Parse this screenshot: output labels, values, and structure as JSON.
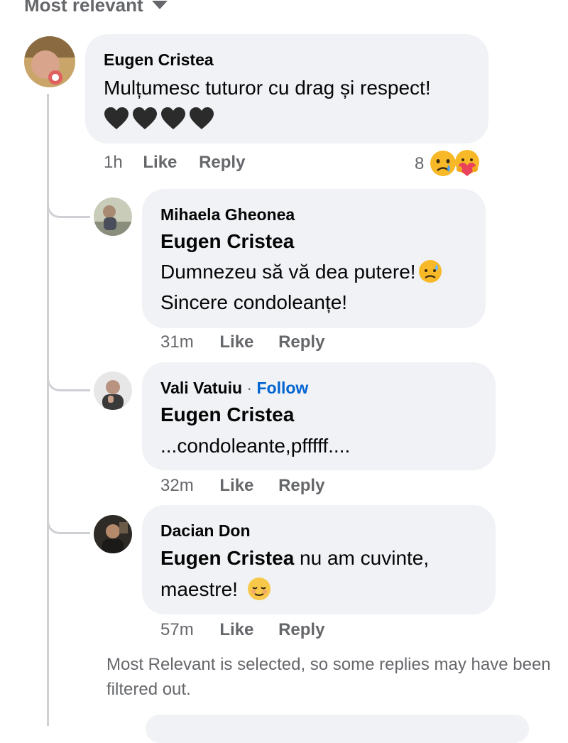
{
  "sort": {
    "label": "Most relevant"
  },
  "main_comment": {
    "author": "Eugen Cristea",
    "text": "Mulțumesc tuturor cu drag și respect!",
    "hearts": "🖤🖤🖤🖤",
    "time": "1h",
    "like_label": "Like",
    "reply_label": "Reply",
    "reaction_count": "8",
    "reactions": [
      "sad-crying-emoji",
      "care-hug-emoji"
    ]
  },
  "replies": [
    {
      "author": "Mihaela Gheonea",
      "tag": "Eugen Cristea",
      "line1": "Dumnezeu să vă dea putere!",
      "line2": "Sincere condoleanțe!",
      "time": "31m",
      "like_label": "Like",
      "reply_label": "Reply"
    },
    {
      "author": "Vali Vatuiu",
      "follow_label": "Follow",
      "tag": "Eugen Cristea",
      "line1": "...condoleante,pfffff....",
      "time": "32m",
      "like_label": "Like",
      "reply_label": "Reply"
    },
    {
      "author": "Dacian Don",
      "tag": "Eugen Cristea",
      "line1_rest": " nu am cuvinte,",
      "line2": "maestre!",
      "time": "57m",
      "like_label": "Like",
      "reply_label": "Reply"
    }
  ],
  "filter_note": "Most Relevant is selected, so some replies may have been filtered out.",
  "colors": {
    "bubble": "#f0f2f5",
    "muted": "#65676b",
    "link": "#0064d1",
    "thread_line": "#ced0d4"
  }
}
